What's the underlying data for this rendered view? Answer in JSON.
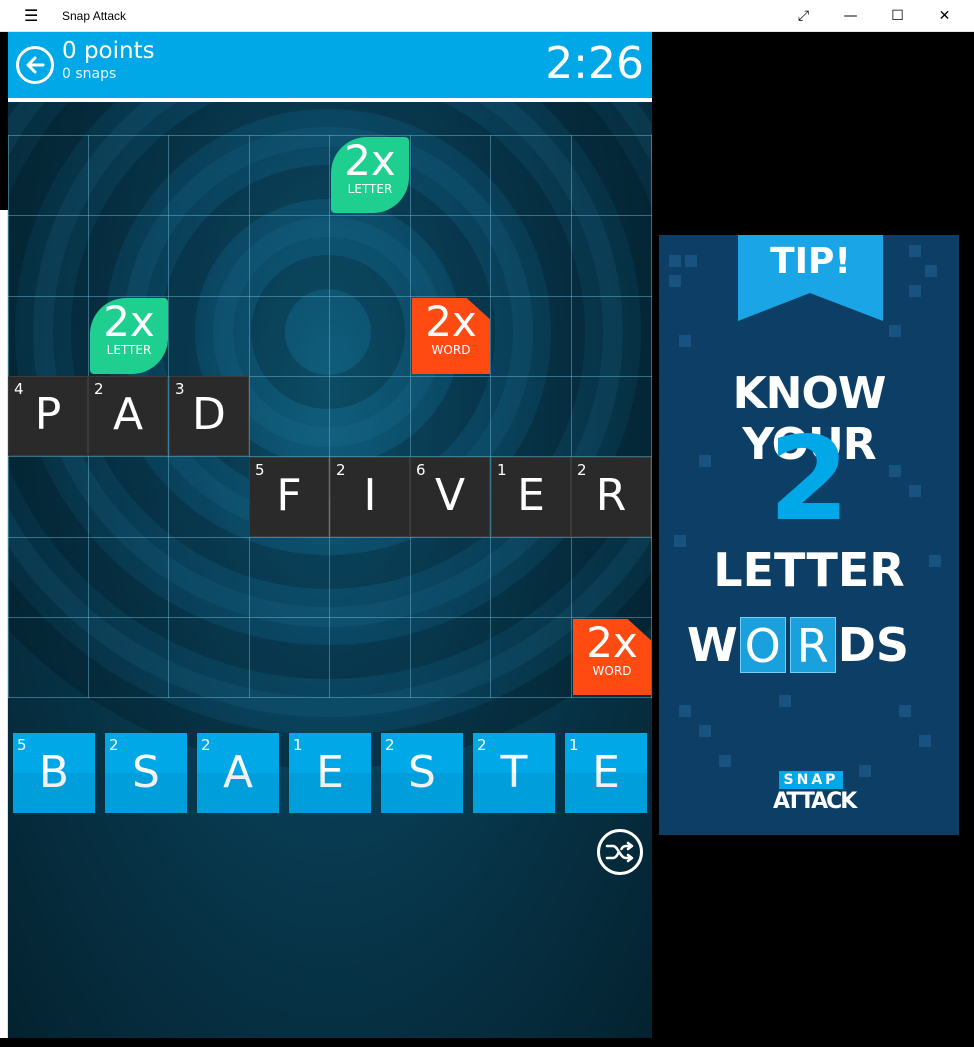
{
  "window": {
    "title": "Snap Attack",
    "controls": {
      "menu_icon": "hamburger-icon",
      "fullscreen_icon": "⤢",
      "minimize": "—",
      "maximize": "☐",
      "close": "✕"
    }
  },
  "header": {
    "points": "0 points",
    "snaps": "0 snaps",
    "timer": "2:26"
  },
  "bonuses": [
    {
      "mult": "2x",
      "kind": "LETTER"
    },
    {
      "mult": "2x",
      "kind": "LETTER"
    },
    {
      "mult": "2x",
      "kind": "WORD"
    },
    {
      "mult": "2x",
      "kind": "WORD"
    }
  ],
  "board_words": {
    "pad": [
      {
        "letter": "P",
        "value": "4"
      },
      {
        "letter": "A",
        "value": "2"
      },
      {
        "letter": "D",
        "value": "3"
      }
    ],
    "fiver": [
      {
        "letter": "F",
        "value": "5"
      },
      {
        "letter": "I",
        "value": "2"
      },
      {
        "letter": "V",
        "value": "6"
      },
      {
        "letter": "E",
        "value": "1"
      },
      {
        "letter": "R",
        "value": "2"
      }
    ]
  },
  "rack": [
    {
      "letter": "B",
      "value": "5"
    },
    {
      "letter": "S",
      "value": "2"
    },
    {
      "letter": "A",
      "value": "2"
    },
    {
      "letter": "E",
      "value": "1"
    },
    {
      "letter": "S",
      "value": "2"
    },
    {
      "letter": "T",
      "value": "2"
    },
    {
      "letter": "E",
      "value": "1"
    }
  ],
  "ad": {
    "tip": "TIP!",
    "line1": "KNOW YOUR",
    "number": "2",
    "line3": "LETTER",
    "words_w": "W",
    "words_o": "O",
    "words_r": "R",
    "words_ds": "DS",
    "logo_top": "SNAP",
    "logo_bottom": "ATTACK"
  },
  "colors": {
    "accent": "#00a8e8",
    "letter_bonus": "#1fcf8f",
    "word_bonus": "#ff4a12",
    "tile_dark": "#2a2a2a"
  }
}
